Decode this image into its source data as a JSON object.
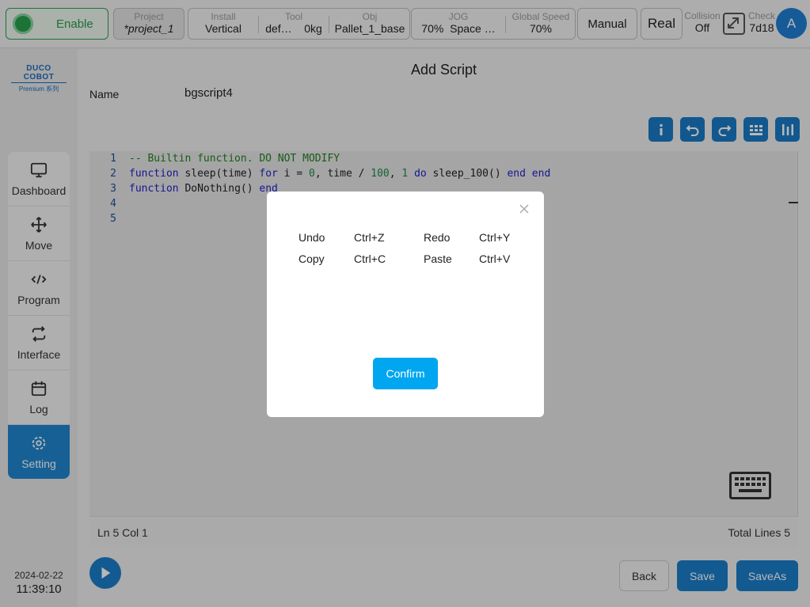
{
  "topbar": {
    "enable_label": "Enable",
    "project": {
      "caption": "Project",
      "value": "*project_1"
    },
    "install": {
      "caption": "Install",
      "value": "Vertical"
    },
    "tool": {
      "caption": "Tool",
      "value1": "def…",
      "value2": "0kg"
    },
    "obj": {
      "caption": "Obj",
      "value": "Pallet_1_base"
    },
    "jog": {
      "caption": "JOG",
      "value1": "70%",
      "value2": "Space …"
    },
    "speed": {
      "caption": "Global Speed",
      "value": "70%"
    },
    "mode_label": "Manual",
    "env_label": "Real",
    "collision": {
      "caption": "Collision",
      "value": "Off"
    },
    "check": {
      "caption": "Check",
      "value": "7d18"
    },
    "avatar_letter": "A"
  },
  "sidebar": {
    "logo_main": "DUCO COBOT",
    "logo_sub": "Premium 系列",
    "items": [
      {
        "label": "Dashboard",
        "icon": "monitor-icon"
      },
      {
        "label": "Move",
        "icon": "move-arrows-icon"
      },
      {
        "label": "Program",
        "icon": "code-icon"
      },
      {
        "label": "Interface",
        "icon": "repeat-icon"
      },
      {
        "label": "Log",
        "icon": "calendar-icon"
      },
      {
        "label": "Setting",
        "icon": "gear-icon"
      }
    ],
    "active": "Setting",
    "date": "2024-02-22",
    "time": "11:39:10"
  },
  "main": {
    "title": "Add Script",
    "name_label": "Name",
    "name_value": "bgscript4",
    "toolbar": [
      "info-icon",
      "undo-icon",
      "redo-icon",
      "keypad-icon",
      "column-icon"
    ],
    "code": {
      "line_numbers": [
        "1",
        "2",
        "3",
        "4",
        "5"
      ],
      "line1": "-- Builtin function. DO NOT MODIFY",
      "l2_function": "function",
      "l2_a": " sleep(time) ",
      "l2_for": "for",
      "l2_b": " i = ",
      "l2_zero": "0",
      "l2_c": ", time / ",
      "l2_hundred": "100",
      "l2_d": ", ",
      "l2_one": "1",
      "l2_e": " ",
      "l2_do": "do",
      "l2_f": " sleep_100() ",
      "l2_end1": "end",
      "l2_g": " ",
      "l2_end2": "end",
      "l3_function": "function",
      "l3_a": " DoNothing() ",
      "l3_end": "end"
    },
    "status_left": "Ln 5 Col 1",
    "status_right": "Total Lines 5",
    "back_label": "Back",
    "save_label": "Save",
    "saveas_label": "SaveAs"
  },
  "modal": {
    "shortcuts": [
      {
        "action": "Undo",
        "keys": "Ctrl+Z"
      },
      {
        "action": "Redo",
        "keys": "Ctrl+Y"
      },
      {
        "action": "Copy",
        "keys": "Ctrl+C"
      },
      {
        "action": "Paste",
        "keys": "Ctrl+V"
      }
    ],
    "confirm_label": "Confirm"
  },
  "colors": {
    "primary": "#1b7dca",
    "confirm": "#00a6f0",
    "enable_green": "#27a04c"
  }
}
